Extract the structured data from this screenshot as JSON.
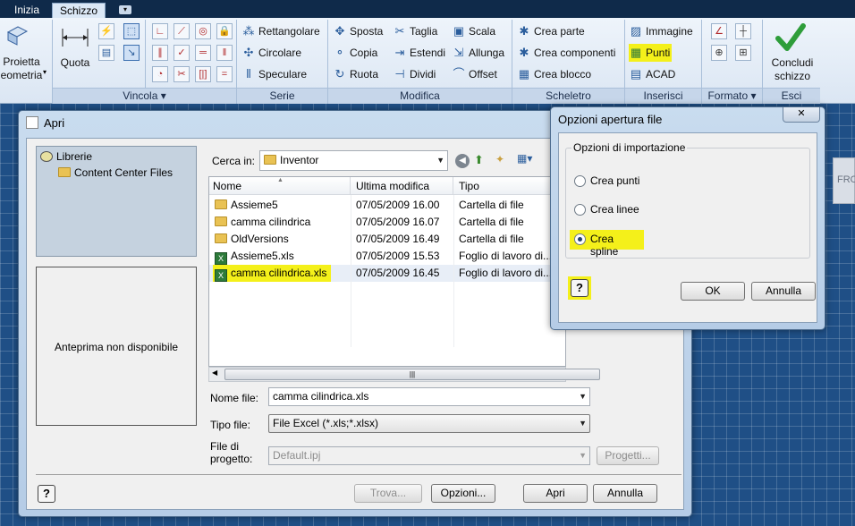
{
  "ribbon": {
    "tabs": [
      "Inizia",
      "Schizzo"
    ],
    "groups": {
      "proietta": {
        "line1": "Proietta",
        "line2": "eometria"
      },
      "quota": "Quota",
      "vincola": "Vincola",
      "serie": "Serie",
      "modifica": "Modifica",
      "scheletro": "Scheletro",
      "inserisci": "Inserisci",
      "formato": "Formato",
      "esci": "Esci"
    },
    "serie_items": [
      "Rettangolare",
      "Circolare",
      "Speculare"
    ],
    "modifica_items": [
      "Sposta",
      "Taglia",
      "Scala",
      "Copia",
      "Estendi",
      "Allunga",
      "Ruota",
      "Dividi",
      "Offset"
    ],
    "scheletro_items": [
      "Crea parte",
      "Crea componenti",
      "Crea blocco"
    ],
    "inserisci_items": [
      "Immagine",
      "Punti",
      "ACAD"
    ],
    "concludi": {
      "line1": "Concludi",
      "line2": "schizzo"
    },
    "partial_label": "FRO"
  },
  "open_dialog": {
    "title": "Apri",
    "libraries": {
      "root": "Librerie",
      "child": "Content Center Files"
    },
    "preview": "Anteprima non disponibile",
    "look_in_label": "Cerca in:",
    "look_in_value": "Inventor",
    "columns": [
      "Nome",
      "Ultima modifica",
      "Tipo"
    ],
    "files": [
      {
        "name": "Assieme5",
        "date": "07/05/2009 16.00",
        "type": "Cartella di file",
        "kind": "folder"
      },
      {
        "name": "camma cilindrica",
        "date": "07/05/2009 16.07",
        "type": "Cartella di file",
        "kind": "folder"
      },
      {
        "name": "OldVersions",
        "date": "07/05/2009 16.49",
        "type": "Cartella di file",
        "kind": "folder"
      },
      {
        "name": "Assieme5.xls",
        "date": "07/05/2009 15.53",
        "type": "Foglio di lavoro di...",
        "kind": "xls"
      },
      {
        "name": "camma cilindrica.xls",
        "date": "07/05/2009 16.45",
        "type": "Foglio di lavoro di...",
        "kind": "xls"
      }
    ],
    "scroll_grip": "|||",
    "file_name_label": "Nome file:",
    "file_name_value": "camma cilindrica.xls",
    "file_type_label": "Tipo file:",
    "file_type_value": "File Excel (*.xls;*.xlsx)",
    "project_label_1": "File di",
    "project_label_2": "progetto:",
    "project_value": "Default.ipj",
    "buttons": {
      "progetti": "Progetti...",
      "trova": "Trova...",
      "opzioni": "Opzioni...",
      "apri": "Apri",
      "annulla": "Annulla"
    }
  },
  "options_dialog": {
    "title": "Opzioni apertura file",
    "group_title": "Opzioni di importazione",
    "options": [
      "Crea punti",
      "Crea linee",
      "Crea spline"
    ],
    "selected": "Crea spline",
    "ok": "OK",
    "cancel": "Annulla"
  },
  "colors": {
    "highlight": "#f4f01a",
    "accent": "#1f4f86"
  }
}
